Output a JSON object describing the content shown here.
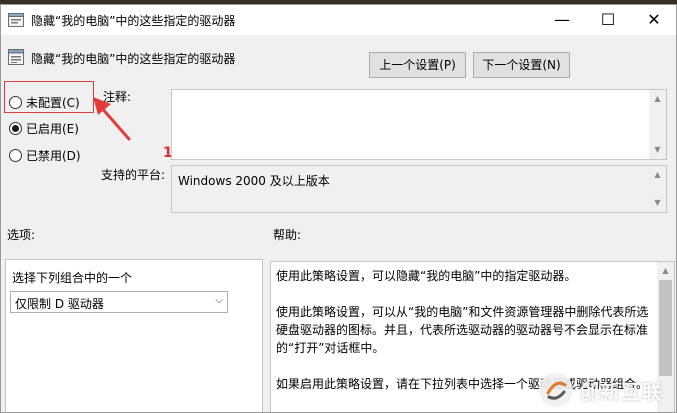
{
  "window": {
    "title": "隐藏“我的电脑”中的这些指定的驱动器",
    "controls": {
      "minimize": "—",
      "maximize": "☐",
      "close": "✕"
    }
  },
  "header": {
    "policy_name": "隐藏“我的电脑”中的这些指定的驱动器",
    "prev_button": "上一个设置(P)",
    "next_button": "下一个设置(N)"
  },
  "state_options": [
    {
      "label": "未配置(C)",
      "checked": false
    },
    {
      "label": "已启用(E)",
      "checked": true
    },
    {
      "label": "已禁用(D)",
      "checked": false
    }
  ],
  "annotation": {
    "number": "1",
    "color": "#e23b3b"
  },
  "comment": {
    "label": "注释:",
    "value": ""
  },
  "supported": {
    "label": "支持的平台:",
    "value": "Windows 2000 及以上版本"
  },
  "options": {
    "label": "选项:",
    "select_label": "选择下列组合中的一个",
    "select_value": "仅限制 D 驱动器"
  },
  "help": {
    "label": "帮助:",
    "paragraphs": [
      "使用此策略设置，可以隐藏“我的电脑”中的指定驱动器。",
      "使用此策略设置，可以从“我的电脑”和文件资源管理器中删除代表所选硬盘驱动器的图标。并且，代表所选驱动器的驱动器号不会显示在标准的“打开”对话框中。",
      "如果启用此策略设置，请在下拉列表中选择一个驱动器或驱动器组合。"
    ]
  },
  "watermark": {
    "text": "创新互联"
  }
}
